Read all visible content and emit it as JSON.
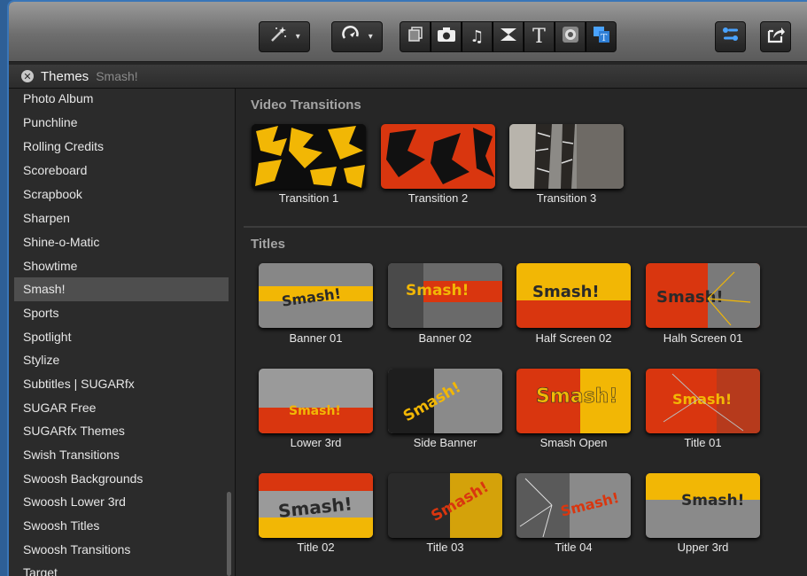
{
  "header": {
    "title": "Themes",
    "subtitle": "Smash!"
  },
  "toolbar": {
    "icons": [
      "magic-wand-icon",
      "retime-icon",
      "clip-browser-icon",
      "camera-icon",
      "music-icon",
      "transitions-icon",
      "titles-icon",
      "generators-icon",
      "themes-icon",
      "inspector-icon",
      "share-icon"
    ],
    "glyphs": {
      "music": "♫",
      "titles": "T"
    }
  },
  "sidebar": {
    "selected": "Smash!",
    "items": [
      "Photo Album",
      "Punchline",
      "Rolling Credits",
      "Scoreboard",
      "Scrapbook",
      "Sharpen",
      "Shine-o-Matic",
      "Showtime",
      "Smash!",
      "Sports",
      "Spotlight",
      "Stylize",
      "Subtitles | SUGARfx",
      "SUGAR Free",
      "SUGARfx Themes",
      "Swish Transitions",
      "Swoosh Backgrounds",
      "Swoosh Lower 3rd",
      "Swoosh Titles",
      "Swoosh Transitions",
      "Target"
    ]
  },
  "sections": {
    "video_transitions": {
      "label": "Video Transitions",
      "items": [
        "Transition 1",
        "Transition 2",
        "Transition 3"
      ]
    },
    "titles": {
      "label": "Titles",
      "items": [
        "Banner 01",
        "Banner 02",
        "Half Screen 02",
        "Halh Screen 01",
        "Lower 3rd",
        "Side Banner",
        "Smash Open",
        "Title 01",
        "Title 02",
        "Title 03",
        "Title 04",
        "Upper 3rd"
      ]
    }
  },
  "colors": {
    "accent": "#4aa3ff",
    "yellow": "#f2b705",
    "red": "#d9360f"
  }
}
